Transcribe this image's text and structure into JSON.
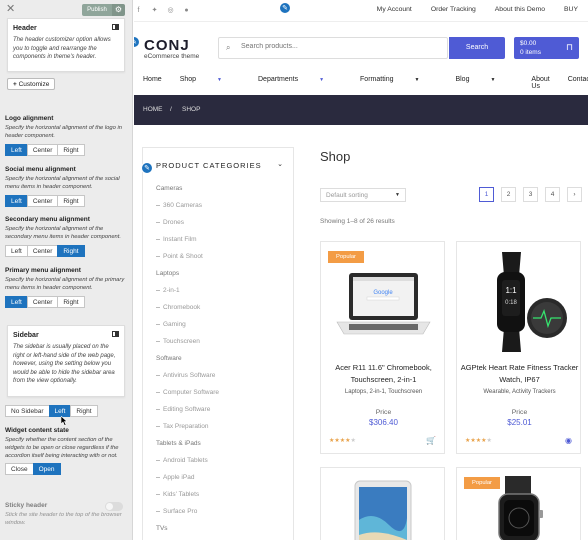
{
  "customizer": {
    "publish_label": "Publish",
    "header_card": {
      "title": "Header",
      "description": "The header customizer option allows you to toggle and rearrange the components in theme's header."
    },
    "customize_button": "Customize",
    "logo_alignment": {
      "label": "Logo alignment",
      "description": "Specify the horizontal alignment of the logo in header component.",
      "options": [
        "Left",
        "Center",
        "Right"
      ],
      "selected": "Left"
    },
    "social_menu_alignment": {
      "label": "Social menu alignment",
      "description": "Specify the horizontal alignment of the social menu items in header component.",
      "options": [
        "Left",
        "Center",
        "Right"
      ],
      "selected": "Left"
    },
    "secondary_menu_alignment": {
      "label": "Secondary menu alignment",
      "description": "Specify the horizontal alignment of the secondary menu items in header component.",
      "options": [
        "Left",
        "Center",
        "Right"
      ],
      "selected": "Right"
    },
    "primary_menu_alignment": {
      "label": "Primary menu alignment",
      "description": "Specify the horizontal alignment of the primary menu items in header component.",
      "options": [
        "Left",
        "Center",
        "Right"
      ],
      "selected": "Left"
    },
    "sidebar_card": {
      "title": "Sidebar",
      "description": "The sidebar is usually placed on the right or left-hand side of the web page, however, using the setting below you would be able to hide the sidebar area from the view optionally."
    },
    "sidebar_position": {
      "options": [
        "No Sidebar",
        "Left",
        "Right"
      ],
      "selected": "Left"
    },
    "widget_content_state": {
      "label": "Widget content state",
      "description": "Specify whether the content section of the widgets to be open or close regardless if the accordion itself being interacting with or not.",
      "options": [
        "Close",
        "Open"
      ],
      "selected": "Open"
    },
    "sticky_header": {
      "label": "Sticky header",
      "description": "Stick the site header to the top of the browser window."
    }
  },
  "colors": {
    "accent": "#4f5bd5",
    "customizer_selected": "#1e73be",
    "breadcrumb_band": "#2a2a3e",
    "badge": "#f39c45",
    "stars": "#e8a24a"
  },
  "preview": {
    "social_icons": [
      "facebook-icon",
      "twitter-icon",
      "instagram-icon",
      "github-icon"
    ],
    "top_links": [
      "My Account",
      "Order Tracking",
      "About this Demo",
      "BUY"
    ],
    "logo_text": "CONJ",
    "tagline": "eCommerce theme",
    "search": {
      "placeholder": "Search products...",
      "button": "Search"
    },
    "cart": {
      "amount": "$0.00",
      "items": "0 items"
    },
    "nav": [
      "Home",
      "Shop",
      "Departments",
      "Formatting",
      "Blog",
      "About Us",
      "Contact"
    ],
    "breadcrumb": [
      "HOME",
      "/",
      "SHOP"
    ],
    "categories_title": "PRODUCT CATEGORIES",
    "categories": [
      {
        "label": "Cameras",
        "level": 0
      },
      {
        "label": "360 Cameras",
        "level": 1
      },
      {
        "label": "Drones",
        "level": 1
      },
      {
        "label": "Instant Film",
        "level": 1
      },
      {
        "label": "Point & Shoot",
        "level": 1
      },
      {
        "label": "Laptops",
        "level": 0
      },
      {
        "label": "2-in-1",
        "level": 1
      },
      {
        "label": "Chromebook",
        "level": 1
      },
      {
        "label": "Gaming",
        "level": 1
      },
      {
        "label": "Touchscreen",
        "level": 1
      },
      {
        "label": "Software",
        "level": 0
      },
      {
        "label": "Antivirus Software",
        "level": 1
      },
      {
        "label": "Computer Software",
        "level": 1
      },
      {
        "label": "Editing Software",
        "level": 1
      },
      {
        "label": "Tax Preparation",
        "level": 1
      },
      {
        "label": "Tablets & iPads",
        "level": 0
      },
      {
        "label": "Android Tablets",
        "level": 1
      },
      {
        "label": "Apple iPad",
        "level": 1
      },
      {
        "label": "Kids' Tablets",
        "level": 1
      },
      {
        "label": "Surface Pro",
        "level": 1
      },
      {
        "label": "TVs",
        "level": 0
      }
    ],
    "shop_title": "Shop",
    "sort_default": "Default sorting",
    "pages": [
      "1",
      "2",
      "3",
      "4",
      "›"
    ],
    "current_page": "1",
    "showing": "Showing 1–8 of 26 results",
    "products": [
      {
        "badge": "Popular",
        "title": "Acer R11 11.6\" Chromebook, Touchscreen, 2-in-1",
        "categories": "Laptops, 2-in-1, Touchscreen",
        "price_label": "Price",
        "price": "$306.40",
        "rating": 4,
        "action_icon": "cart-icon"
      },
      {
        "badge": "",
        "title": "AGPtek Heart Rate Fitness Tracker Watch, IP67",
        "categories": "Wearable, Activity Trackers",
        "price_label": "Price",
        "price": "$25.01",
        "rating": 4,
        "action_icon": "eye-icon"
      },
      {
        "badge": ""
      },
      {
        "badge": "Popular"
      }
    ]
  }
}
